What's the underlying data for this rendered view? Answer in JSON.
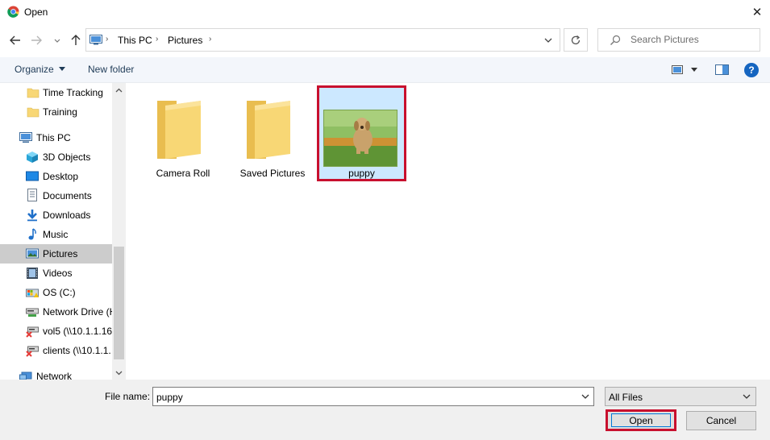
{
  "window": {
    "title": "Open",
    "close_glyph": "✕"
  },
  "address": {
    "crumbs": [
      "This PC",
      "Pictures"
    ],
    "sep_glyph": "›"
  },
  "search": {
    "placeholder": "Search Pictures"
  },
  "commandbar": {
    "organize_label": "Organize",
    "new_folder_label": "New folder",
    "help_label": "?"
  },
  "nav": {
    "items": [
      {
        "label": "Time Tracking",
        "icon": "folder-icon"
      },
      {
        "label": "Training",
        "icon": "folder-icon"
      },
      {
        "label": "This PC",
        "icon": "computer-icon"
      },
      {
        "label": "3D Objects",
        "icon": "3d-objects-icon"
      },
      {
        "label": "Desktop",
        "icon": "desktop-icon"
      },
      {
        "label": "Documents",
        "icon": "documents-icon"
      },
      {
        "label": "Downloads",
        "icon": "downloads-icon"
      },
      {
        "label": "Music",
        "icon": "music-icon"
      },
      {
        "label": "Pictures",
        "icon": "pictures-icon",
        "selected": true
      },
      {
        "label": "Videos",
        "icon": "videos-icon"
      },
      {
        "label": "OS (C:)",
        "icon": "drive-icon"
      },
      {
        "label": "Network Drive (H",
        "icon": "network-drive-icon"
      },
      {
        "label": "vol5 (\\\\10.1.1.16!",
        "icon": "disconnected-drive-icon"
      },
      {
        "label": "clients (\\\\10.1.1.",
        "icon": "disconnected-drive-icon"
      },
      {
        "label": "Network",
        "icon": "network-icon"
      }
    ]
  },
  "files": [
    {
      "name": "Camera Roll",
      "type": "folder"
    },
    {
      "name": "Saved Pictures",
      "type": "folder"
    },
    {
      "name": "puppy",
      "type": "image",
      "selected": true
    }
  ],
  "bottom": {
    "filename_label": "File name:",
    "filename_value": "puppy",
    "filetype_value": "All Files",
    "open_label": "Open",
    "cancel_label": "Cancel"
  },
  "colors": {
    "highlight_red": "#c8102e",
    "selection_blue": "#cce8ff",
    "accent_blue": "#0078d7"
  }
}
